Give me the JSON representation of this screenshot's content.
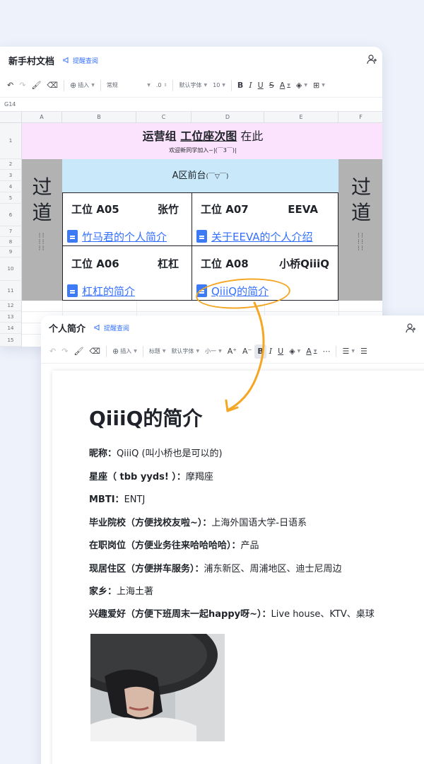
{
  "sheet": {
    "title": "新手村文档",
    "remind_label": "提醒查阅",
    "toolbar": {
      "insert": "插入",
      "format": "常规",
      "decimal": ".0",
      "font": "默认字体",
      "size": "10"
    },
    "cell_ref": "G14",
    "columns": [
      "A",
      "B",
      "C",
      "D",
      "E",
      "F"
    ],
    "rows": [
      "1",
      "2",
      "3",
      "4",
      "5",
      "6",
      "7",
      "8",
      "9",
      "10",
      "11",
      "12",
      "13",
      "14",
      "15"
    ],
    "header_title_part1": "运营组 ",
    "header_title_part2": "工位座次图",
    "header_title_part3": " 在此",
    "header_sub": "欢迎新同学加入~|(￣3￣)|",
    "aisle_left": [
      "过",
      "道"
    ],
    "aisle_right": [
      "过",
      "道"
    ],
    "aisle_feet": "👣\n👣\n👣",
    "front_desk": "A区前台",
    "front_desk_emoji": "(￣▽￣)",
    "seats": [
      {
        "id": "工位 A05",
        "name": "张竹",
        "link": "竹马君的个人简介"
      },
      {
        "id": "工位  A07",
        "name": "EEVA",
        "link": "关于EEVA的个人介绍"
      },
      {
        "id": "工位  A06",
        "name": "杠杠",
        "link": "杠杠的简介"
      },
      {
        "id": "工位  A08",
        "name": "小桥QiiiQ",
        "link": "QiiiQ的简介"
      }
    ]
  },
  "doc": {
    "title": "个人简介",
    "remind_label": "提醒查阅",
    "toolbar": {
      "insert": "插入",
      "heading": "标题",
      "font": "默认字体",
      "size": "小一"
    },
    "heading": "QiiiQ的简介",
    "fields": [
      {
        "label": "昵称：",
        "value": "QiiiQ (叫小桥也是可以的)"
      },
      {
        "label": "星座（ tbb yyds! ）：",
        "value": "摩羯座"
      },
      {
        "label": "MBTI：",
        "value": "ENTJ"
      },
      {
        "label": "毕业院校（方便找校友啦~）：",
        "value": "上海外国语大学-日语系"
      },
      {
        "label": "在职岗位（方便业务往来哈哈哈哈）：",
        "value": "产品"
      },
      {
        "label": "现居住区（方便拼车服务）：",
        "value": "浦东新区、周浦地区、迪士尼周边"
      },
      {
        "label": "家乡：",
        "value": "上海土著"
      },
      {
        "label": "兴趣爱好（方便下班周末一起happy呀~）：",
        "value": "Live house、KTV、桌球"
      }
    ]
  },
  "colors": {
    "accent": "#3370ff",
    "highlight": "#f5a623",
    "header_pink": "#fce3fd",
    "front_blue": "#c9e9fb",
    "aisle_gray": "#b2b2b2"
  }
}
